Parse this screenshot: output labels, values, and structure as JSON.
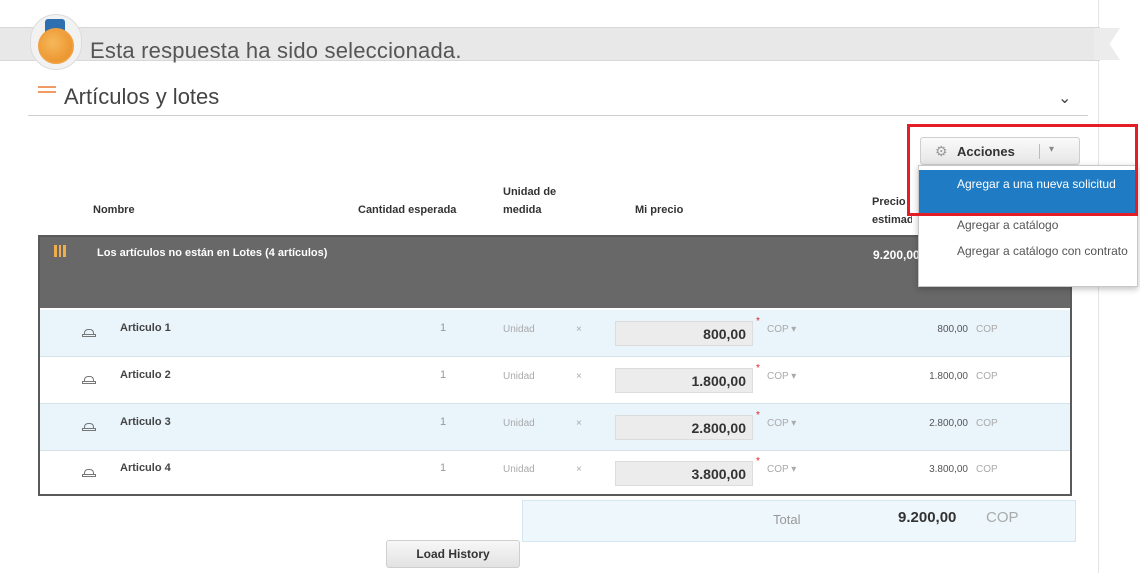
{
  "banner": {
    "text": "Esta respuesta ha sido seleccionada."
  },
  "section": {
    "title": "Artículos y lotes",
    "chevron": "⌄"
  },
  "actions": {
    "label": "Acciones",
    "caret": "▾",
    "menu": [
      "Agregar a una nueva solicitud",
      "Agregar a catálogo",
      "Agregar a catálogo con contrato"
    ]
  },
  "table": {
    "headers": {
      "nombre": "Nombre",
      "cantidad": "Cantidad esperada",
      "unidad": "Unidad de medida",
      "precio": "Mi precio",
      "precio_estimado": "Precio estimado"
    },
    "group": {
      "title": "Los artículos no están en Lotes (4 artículos)",
      "total": "9.200,00"
    },
    "rows": [
      {
        "name": "Articulo 1",
        "qty": "1",
        "unit": "Unidad",
        "x": "×",
        "price": "800,00",
        "req": "*",
        "currency": "COP ▾",
        "total": "800,00",
        "total_currency": "COP"
      },
      {
        "name": "Articulo 2",
        "qty": "1",
        "unit": "Unidad",
        "x": "×",
        "price": "1.800,00",
        "req": "*",
        "currency": "COP ▾",
        "total": "1.800,00",
        "total_currency": "COP"
      },
      {
        "name": "Articulo 3",
        "qty": "1",
        "unit": "Unidad",
        "x": "×",
        "price": "2.800,00",
        "req": "*",
        "currency": "COP ▾",
        "total": "2.800,00",
        "total_currency": "COP"
      },
      {
        "name": "Articulo 4",
        "qty": "1",
        "unit": "Unidad",
        "x": "×",
        "price": "3.800,00",
        "req": "*",
        "currency": "COP ▾",
        "total": "3.800,00",
        "total_currency": "COP"
      }
    ]
  },
  "total": {
    "label": "Total",
    "value": "9.200,00",
    "currency": "COP"
  },
  "load_history": "Load History",
  "colors": {
    "accent": "#1f7bc3",
    "highlight": "#e41e26",
    "group_band": "#686868",
    "row_alt": "#e9f4fb"
  }
}
